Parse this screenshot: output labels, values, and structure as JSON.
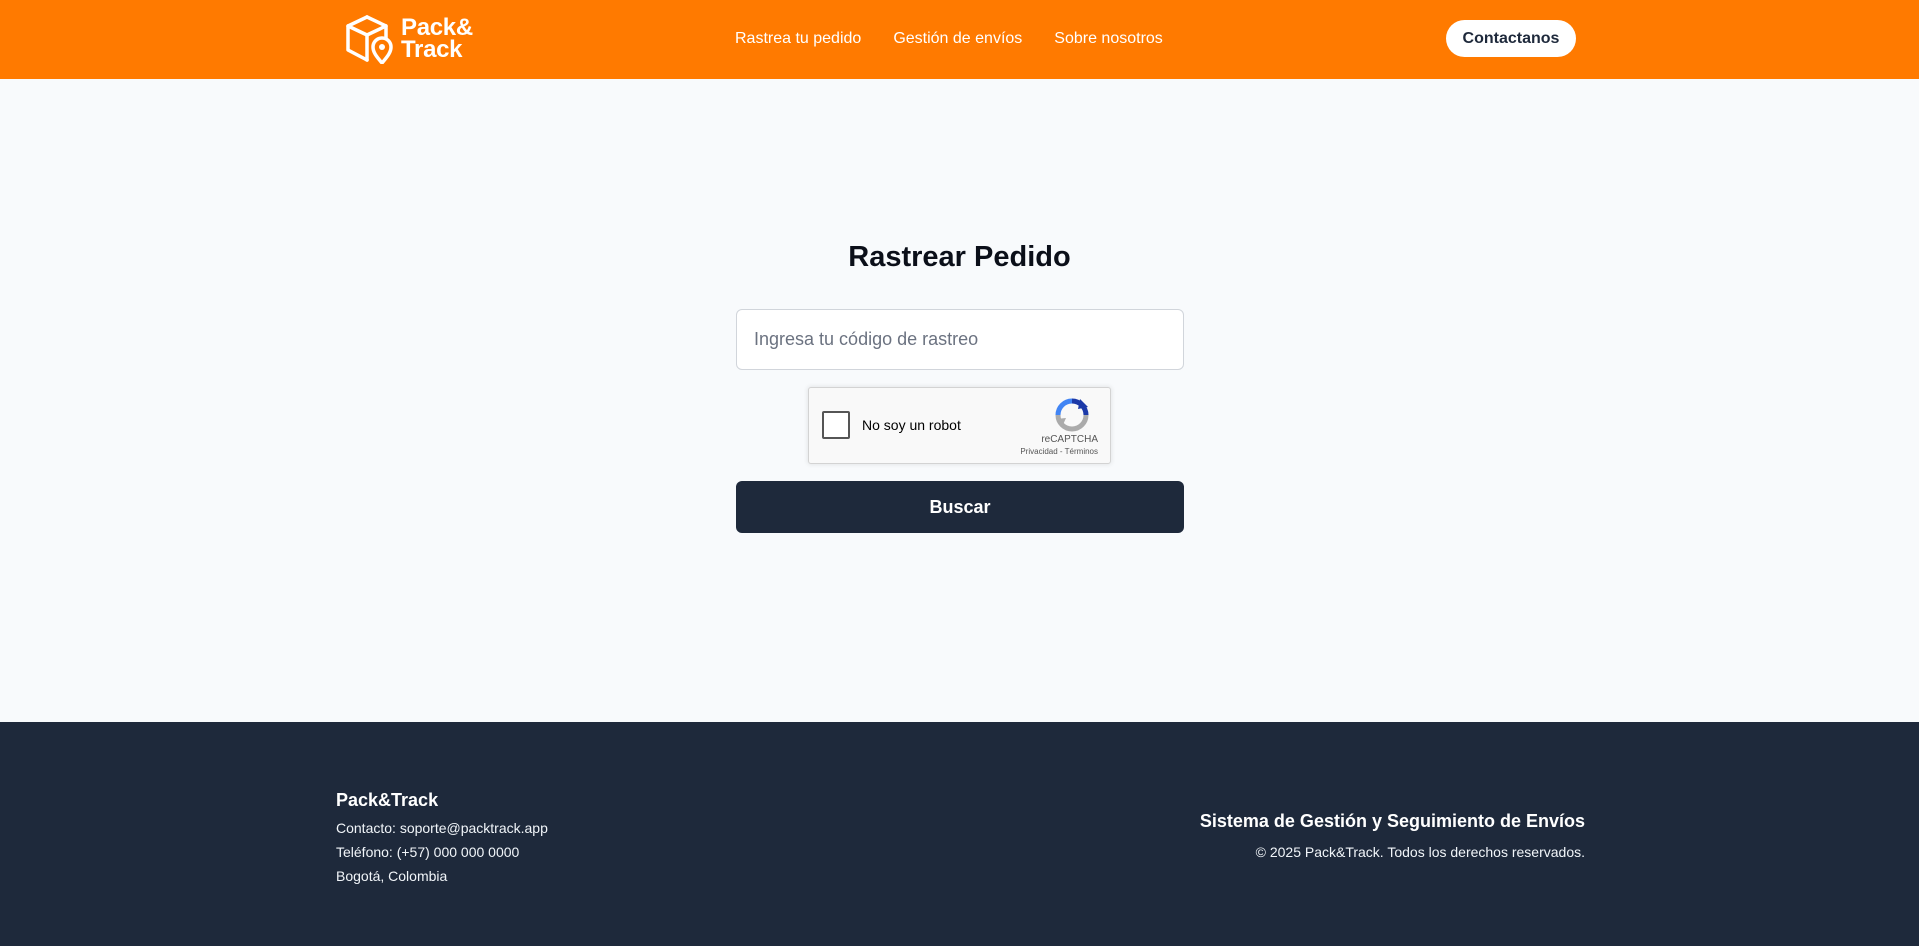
{
  "header": {
    "logo_line1": "Pack&",
    "logo_line2": "Track",
    "nav": [
      {
        "label": "Rastrea tu pedido"
      },
      {
        "label": "Gestión de envíos"
      },
      {
        "label": "Sobre nosotros"
      }
    ],
    "contact_button": "Contactanos"
  },
  "main": {
    "title": "Rastrear Pedido",
    "tracking_input": {
      "value": "",
      "placeholder": "Ingresa tu código de rastreo"
    },
    "captcha": {
      "label": "No soy un robot",
      "brand": "reCAPTCHA",
      "links": "Privacidad - Términos",
      "checked": false
    },
    "search_button": "Buscar"
  },
  "footer": {
    "brand": "Pack&Track",
    "contact": "Contacto: soporte@packtrack.app",
    "phone": "Teléfono: (+57) 000 000 0000",
    "city": "Bogotá, Colombia",
    "tagline": "Sistema de Gestión y Seguimiento de Envíos",
    "copyright": "© 2025 Pack&Track. Todos los derechos reservados."
  },
  "colors": {
    "header_bg": "#ff7a00",
    "page_bg": "#f8fafc",
    "primary_dark": "#1e293b",
    "white": "#ffffff"
  },
  "icons": {
    "logo": "box-location-pin-icon",
    "captcha": "recaptcha-icon"
  }
}
